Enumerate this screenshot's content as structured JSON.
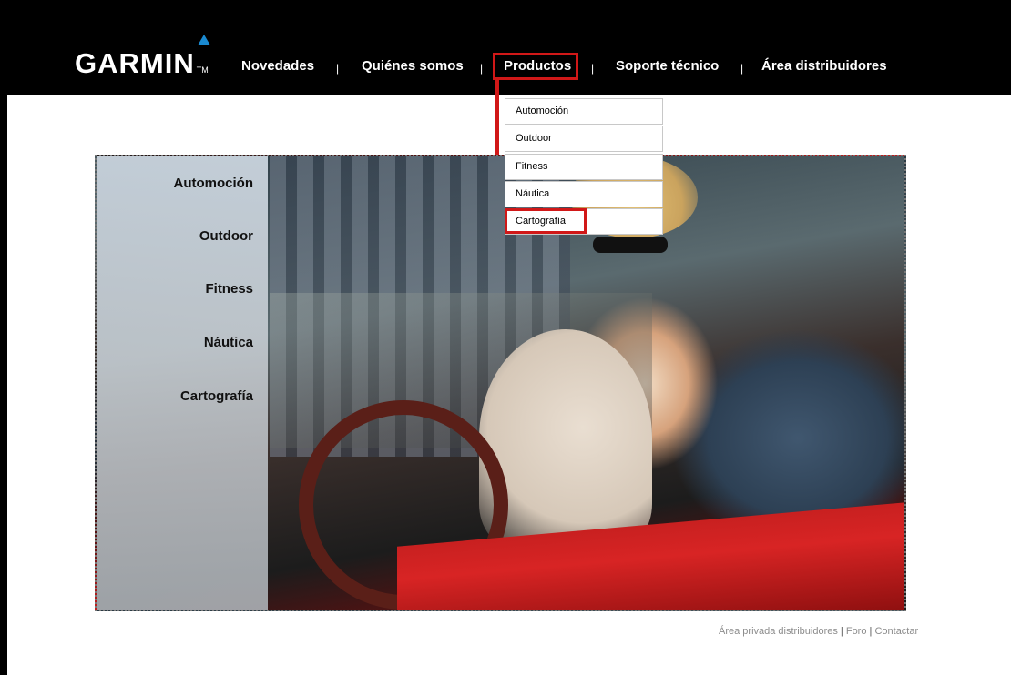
{
  "brand": {
    "name": "GARMIN",
    "trademark": "TM",
    "accent": "#1a8ad1"
  },
  "nav": {
    "items": [
      {
        "label": "Novedades"
      },
      {
        "label": "Quiénes somos"
      },
      {
        "label": "Productos"
      },
      {
        "label": "Soporte técnico"
      },
      {
        "label": "Área distribuidores"
      }
    ],
    "separator": "|",
    "active": "Productos",
    "highlight_color": "#d11818"
  },
  "dropdown": {
    "items": [
      {
        "label": "Automoción"
      },
      {
        "label": "Outdoor"
      },
      {
        "label": "Fitness"
      },
      {
        "label": "Náutica"
      },
      {
        "label": "Cartografía"
      }
    ],
    "highlighted": "Cartografía"
  },
  "hero": {
    "side_menu": [
      {
        "label": "Automoción"
      },
      {
        "label": "Outdoor"
      },
      {
        "label": "Fitness"
      },
      {
        "label": "Náutica"
      },
      {
        "label": "Cartografía"
      }
    ]
  },
  "footer": {
    "links": [
      {
        "label": "Área privada distribuidores"
      },
      {
        "label": "Foro"
      },
      {
        "label": "Contactar"
      }
    ],
    "separator": "|"
  }
}
